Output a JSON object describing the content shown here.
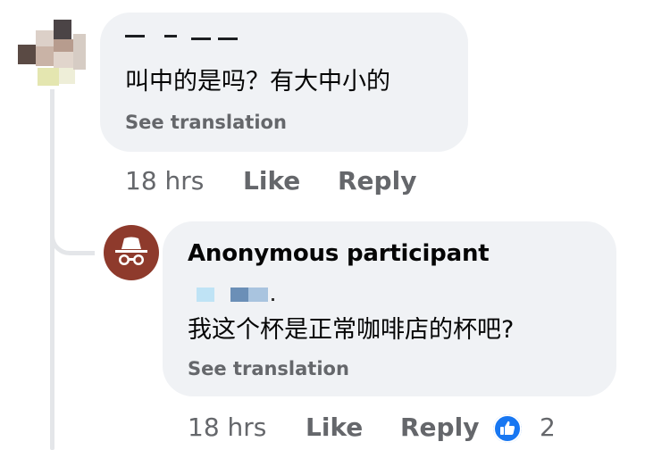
{
  "comment_1": {
    "text": "叫中的是吗？有大中小的",
    "see_translation": "See translation",
    "time": "18 hrs",
    "like_label": "Like",
    "reply_label": "Reply"
  },
  "comment_2": {
    "author": "Anonymous participant",
    "text": "我这个杯是正常咖啡店的杯吧?",
    "see_translation": "See translation",
    "time": "18 hrs",
    "like_label": "Like",
    "reply_label": "Reply",
    "reaction_count": "2"
  },
  "colors": {
    "bubble_bg": "#f0f2f5",
    "muted_text": "#65676b",
    "main_text": "#050505",
    "like_blue": "#1877f2",
    "anon_avatar_bg": "#8e3a2c"
  },
  "icons": {
    "anonymous_avatar": "incognito-icon",
    "reaction": "thumbs-up-icon"
  }
}
